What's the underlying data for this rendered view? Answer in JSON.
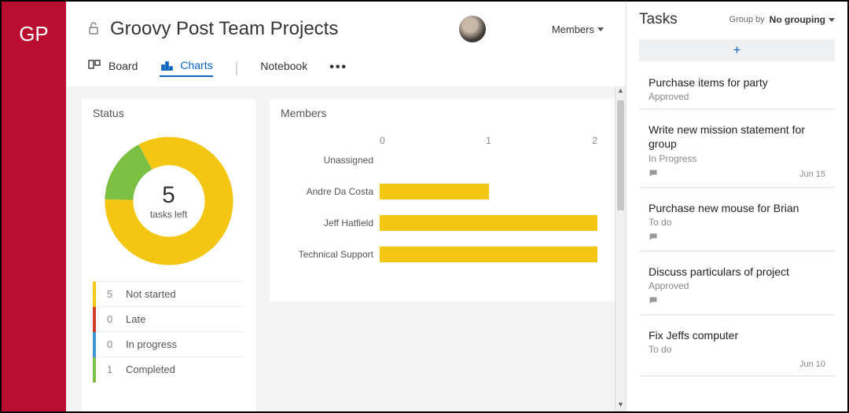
{
  "brand": "GP",
  "header": {
    "title": "Groovy Post Team Projects",
    "members_dropdown": "Members"
  },
  "tabs": {
    "board": "Board",
    "charts": "Charts",
    "notebook": "Notebook"
  },
  "status": {
    "title": "Status",
    "center_value": "5",
    "center_label": "tasks left",
    "legend": [
      {
        "count": "5",
        "label": "Not started",
        "color": "#f3c711"
      },
      {
        "count": "0",
        "label": "Late",
        "color": "#d23a2a"
      },
      {
        "count": "0",
        "label": "In progress",
        "color": "#3f97d8"
      },
      {
        "count": "1",
        "label": "Completed",
        "color": "#7bc043"
      }
    ]
  },
  "members_chart": {
    "title": "Members",
    "ticks": [
      "0",
      "1",
      "2"
    ],
    "rows": [
      {
        "label": "Unassigned",
        "value": 0
      },
      {
        "label": "Andre Da Costa",
        "value": 1
      },
      {
        "label": "Jeff Hatfield",
        "value": 2
      },
      {
        "label": "Technical Support",
        "value": 2
      }
    ],
    "max": 2
  },
  "tasks_panel": {
    "title": "Tasks",
    "group_by_label": "Group by",
    "group_by_value": "No grouping",
    "tasks": [
      {
        "title": "Purchase items for party",
        "status": "Approved",
        "has_comment": false,
        "date": ""
      },
      {
        "title": "Write new mission statement for group",
        "status": "In Progress",
        "has_comment": true,
        "date": "Jun 15"
      },
      {
        "title": "Purchase new mouse for Brian",
        "status": "To do",
        "has_comment": true,
        "date": ""
      },
      {
        "title": "Discuss particulars of project",
        "status": "Approved",
        "has_comment": true,
        "date": ""
      },
      {
        "title": "Fix Jeffs computer",
        "status": "To do",
        "has_comment": false,
        "date": "Jun 10"
      }
    ]
  },
  "chart_data": [
    {
      "type": "pie",
      "title": "Status",
      "categories": [
        "Not started",
        "Late",
        "In progress",
        "Completed"
      ],
      "values": [
        5,
        0,
        0,
        1
      ],
      "colors": [
        "#f3c711",
        "#d23a2a",
        "#3f97d8",
        "#7bc043"
      ],
      "center_text": "5 tasks left"
    },
    {
      "type": "bar",
      "title": "Members",
      "categories": [
        "Unassigned",
        "Andre Da Costa",
        "Jeff Hatfield",
        "Technical Support"
      ],
      "values": [
        0,
        1,
        2,
        2
      ],
      "xlabel": "",
      "ylabel": "",
      "xlim": [
        0,
        2
      ]
    }
  ]
}
